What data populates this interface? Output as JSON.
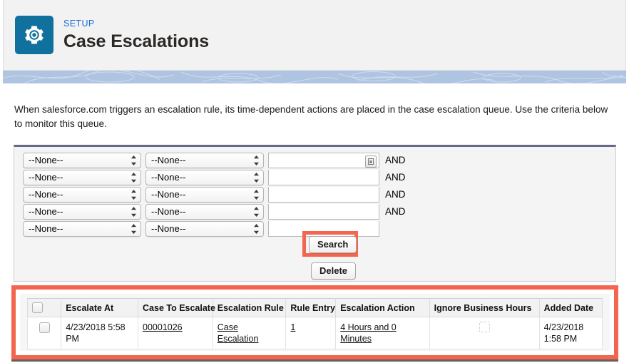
{
  "header": {
    "eyebrow": "SETUP",
    "title": "Case Escalations",
    "gear_icon": "gear-icon",
    "tile_color": "#10709e",
    "eyebrow_color": "#1b6bd8"
  },
  "intro": {
    "text": "When salesforce.com triggers an escalation rule, its time-dependent actions are placed in the case escalation queue. Use the criteria below to monitor this queue."
  },
  "filter": {
    "none_option": "--None--",
    "and_label": "AND",
    "lookup_icon": "lookup-picklist-icon",
    "rows": [
      {
        "field": "--None--",
        "operator": "--None--",
        "value": "",
        "has_lookup": true,
        "and": "AND"
      },
      {
        "field": "--None--",
        "operator": "--None--",
        "value": "",
        "has_lookup": false,
        "and": "AND"
      },
      {
        "field": "--None--",
        "operator": "--None--",
        "value": "",
        "has_lookup": false,
        "and": "AND"
      },
      {
        "field": "--None--",
        "operator": "--None--",
        "value": "",
        "has_lookup": false,
        "and": "AND"
      },
      {
        "field": "--None--",
        "operator": "--None--",
        "value": "",
        "has_lookup": false,
        "and": ""
      }
    ],
    "search_label": "Search",
    "delete_label": "Delete",
    "highlight_color": "#f4654f"
  },
  "results": {
    "highlight_color": "#f4654f",
    "columns": [
      "",
      "Escalate At",
      "Case To Escalate",
      "Escalation Rule",
      "Rule Entry",
      "Escalation Action",
      "Ignore Business Hours",
      "Added Date"
    ],
    "rows": [
      {
        "escalate_at": "4/23/2018 5:58 PM",
        "case_to_escalate": "00001026",
        "escalation_rule": "Case Escalation",
        "rule_entry": "1",
        "escalation_action": "4 Hours and 0 Minutes",
        "ignore_business_hours": "",
        "added_date": "4/23/2018 1:58 PM"
      }
    ]
  }
}
